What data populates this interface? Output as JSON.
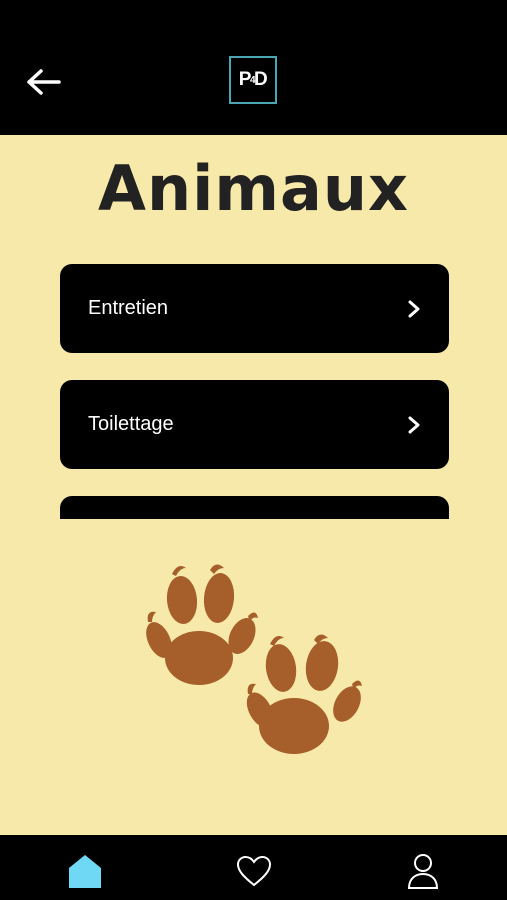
{
  "header": {
    "back_icon": "arrow-left-icon",
    "logo_text": {
      "p": "P",
      "small": "4",
      "d": "D"
    },
    "logo_border_color": "#4aa6b3"
  },
  "page": {
    "title": "Animaux",
    "background_color": "#f7e9a9"
  },
  "menu": {
    "items": [
      {
        "label": "Entretien",
        "icon": "chevron-right-icon"
      },
      {
        "label": "Toilettage",
        "icon": "chevron-right-icon"
      }
    ]
  },
  "decoration": {
    "icon": "paw-prints-icon",
    "color": "#a65e2a"
  },
  "tabbar": {
    "tabs": [
      {
        "icon": "home-icon",
        "active": true,
        "color": "#6fd8f5"
      },
      {
        "icon": "heart-icon",
        "active": false
      },
      {
        "icon": "user-icon",
        "active": false
      }
    ]
  }
}
